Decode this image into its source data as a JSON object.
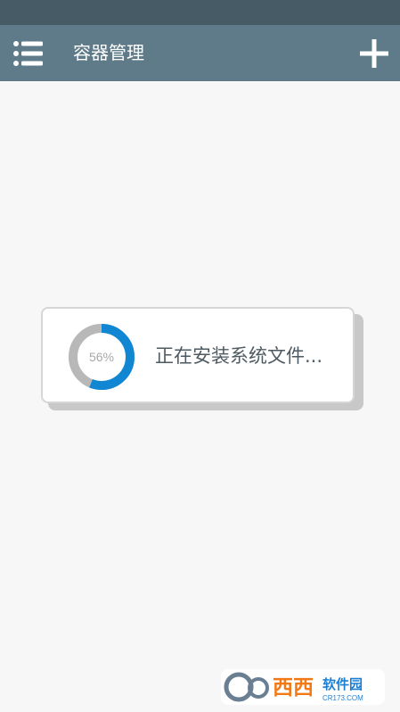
{
  "colors": {
    "status_bar": "#475b67",
    "app_bar": "#5f7b89",
    "background": "#f7f7f7",
    "progress_active": "#1187d3",
    "progress_track": "#b8b8b8",
    "dialog_text": "#4e5a61"
  },
  "app_bar": {
    "title": "容器管理",
    "menu_icon": "list-menu-icon",
    "add_icon": "plus-icon"
  },
  "progress_dialog": {
    "percent": 56,
    "percent_label": "56%",
    "message": "正在安装系统文件..."
  },
  "watermark": {
    "brand": "西西",
    "name": "软件园",
    "site": "CR173.COM"
  }
}
